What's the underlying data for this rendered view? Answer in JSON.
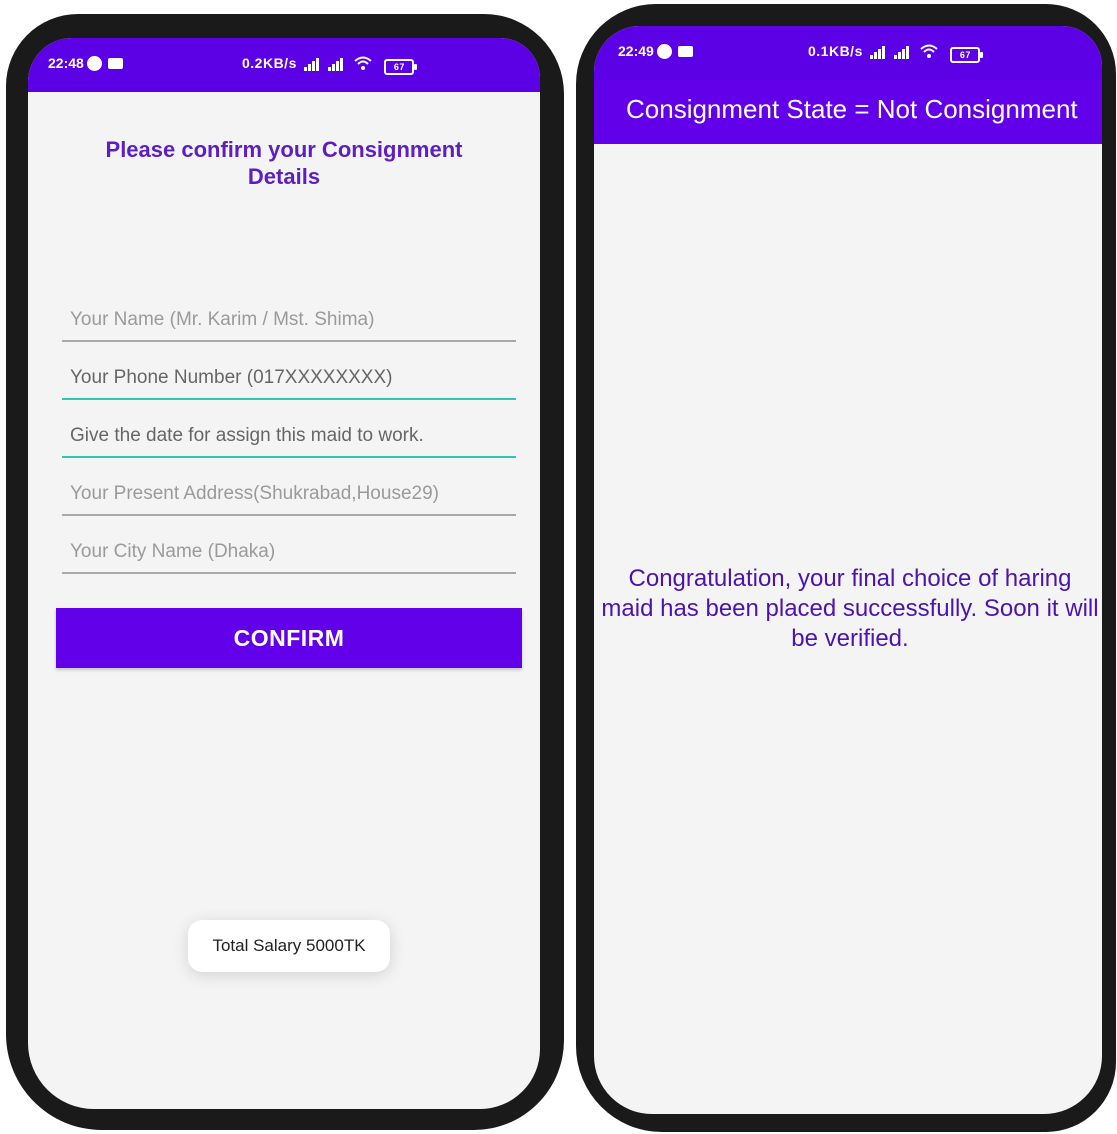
{
  "left_screen": {
    "status_bar": {
      "time": "22:48",
      "network_speed": "0.2KB/s",
      "battery": "67"
    },
    "title": "Please confirm your Consignment Details",
    "fields": [
      {
        "placeholder": "Your Name (Mr. Karim / Mst. Shima)"
      },
      {
        "placeholder": "Your Phone Number (017XXXXXXXX)"
      },
      {
        "placeholder": "Give the date for assign this maid to work."
      },
      {
        "placeholder": "Your Present Address(Shukrabad,House29)"
      },
      {
        "placeholder": "Your City Name (Dhaka)"
      }
    ],
    "confirm_label": "CONFIRM",
    "toast": "Total Salary 5000TK"
  },
  "right_screen": {
    "status_bar": {
      "time": "22:49",
      "network_speed": "0.1KB/s",
      "battery": "67"
    },
    "app_bar_title": "Consignment State = Not Consignment",
    "message": "Congratulation, your final choice of haring maid has been placed successfully. Soon it will be verified."
  },
  "colors": {
    "primary": "#6200ea",
    "status_bar": "#5c00e6",
    "title_text": "#5b1fc2",
    "active_underline": "#2ec6b4",
    "background": "#f4f4f5"
  }
}
